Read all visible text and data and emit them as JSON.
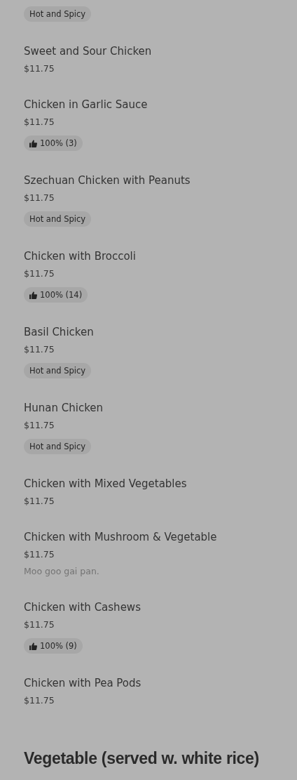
{
  "items": [
    {
      "tags": [
        {
          "kind": "label",
          "text": "Hot and Spicy"
        }
      ]
    },
    {
      "name": "Sweet and Sour Chicken",
      "price": "$11.75"
    },
    {
      "name": "Chicken in Garlic Sauce",
      "price": "$11.75",
      "tags": [
        {
          "kind": "rating",
          "text": "100% (3)"
        }
      ]
    },
    {
      "name": "Szechuan Chicken with Peanuts",
      "price": "$11.75",
      "tags": [
        {
          "kind": "label",
          "text": "Hot and Spicy"
        }
      ]
    },
    {
      "name": "Chicken with Broccoli",
      "price": "$11.75",
      "tags": [
        {
          "kind": "rating",
          "text": "100% (14)"
        }
      ]
    },
    {
      "name": "Basil Chicken",
      "price": "$11.75",
      "tags": [
        {
          "kind": "label",
          "text": "Hot and Spicy"
        }
      ]
    },
    {
      "name": "Hunan Chicken",
      "price": "$11.75",
      "tags": [
        {
          "kind": "label",
          "text": "Hot and Spicy"
        }
      ]
    },
    {
      "name": "Chicken with Mixed Vegetables",
      "price": "$11.75"
    },
    {
      "name": "Chicken with Mushroom & Vegetable",
      "price": "$11.75",
      "description": "Moo goo gai pan."
    },
    {
      "name": "Chicken with Cashews",
      "price": "$11.75",
      "tags": [
        {
          "kind": "rating",
          "text": "100% (9)"
        }
      ]
    },
    {
      "name": "Chicken with Pea Pods",
      "price": "$11.75"
    }
  ],
  "next_section": {
    "title": "Vegetable (served w. white rice)"
  }
}
